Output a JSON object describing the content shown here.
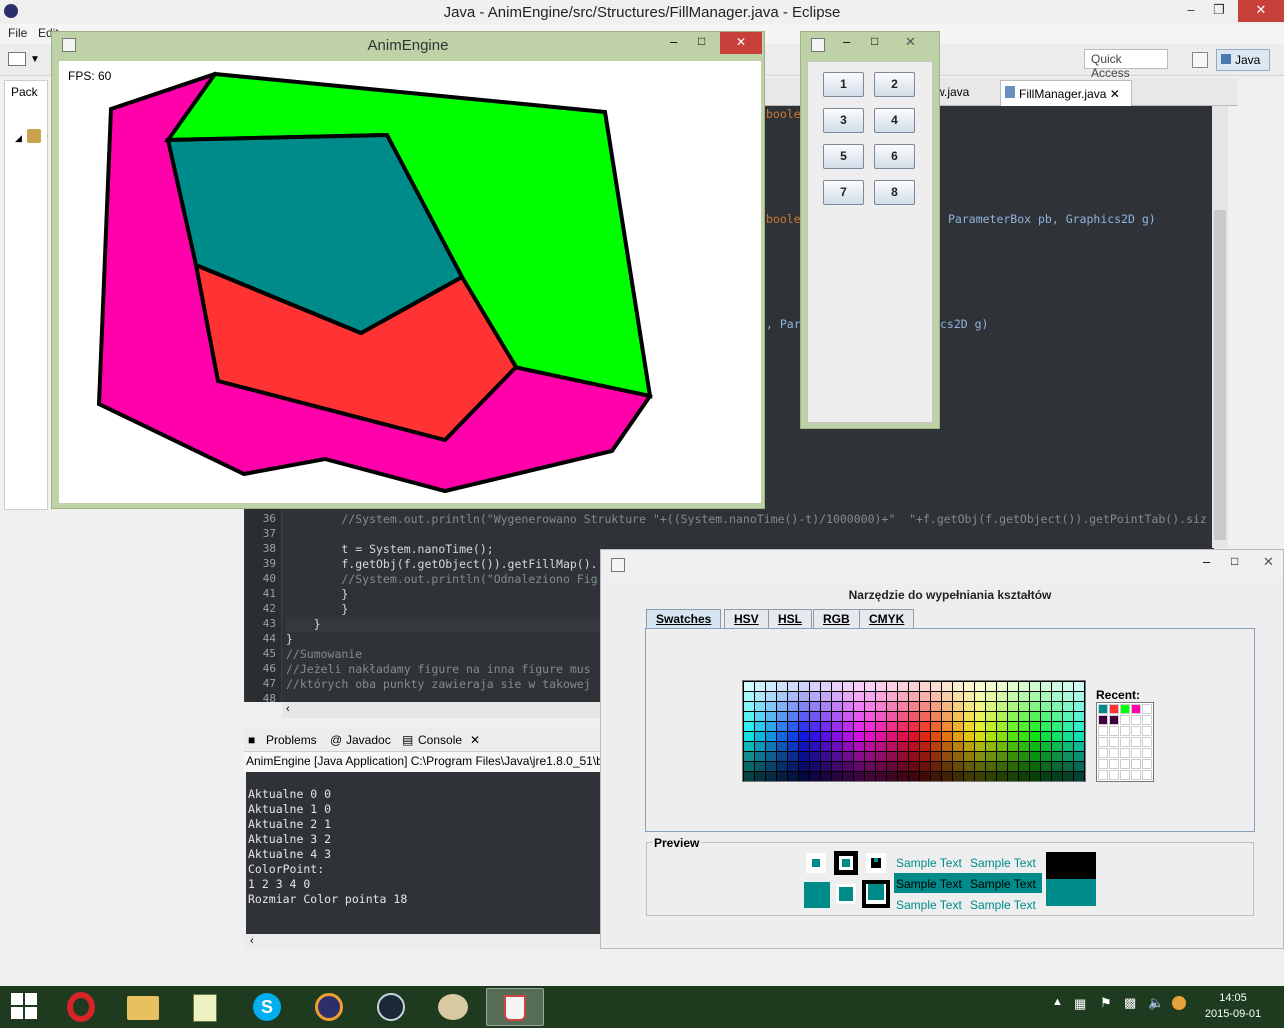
{
  "eclipse": {
    "title": "Java - AnimEngine/src/Structures/FillManager.java - Eclipse",
    "menu": [
      "File",
      "Edit"
    ],
    "quick_access": "Quick Access",
    "perspective": "Java",
    "package_tab": "Pack",
    "editor_tabs": [
      "w.java",
      "FillManager.java"
    ],
    "code": [
      {
        "n": "36",
        "text": "        //System.out.println(\"Wygenerowano Strukture \"+((System.nanoTime()-t)/1000000)+\"  \"+f.getObj(f.getObject()).getPointTab().siz"
      },
      {
        "n": "37",
        "text": ""
      },
      {
        "n": "38",
        "text": "        t = System.nanoTime();"
      },
      {
        "n": "39",
        "text": "        f.getObj(f.getObject()).getFillMap()."
      },
      {
        "n": "40",
        "text": "        //System.out.println(\"Odnaleziono Fig"
      },
      {
        "n": "41",
        "text": "        }"
      },
      {
        "n": "42",
        "text": "        }"
      },
      {
        "n": "43",
        "text": "    }"
      },
      {
        "n": "44",
        "text": "}"
      },
      {
        "n": "45",
        "text": "//Sumowanie"
      },
      {
        "n": "46",
        "text": "//Jeżeli nakładamy figure na inna figure mus"
      },
      {
        "n": "47",
        "text": "//których oba punkty zawieraja sie w takowej"
      },
      {
        "n": "48",
        "text": ""
      }
    ],
    "code_fragments": [
      "boole",
      "boole",
      "ParameterBox pb, Graphics2D g)",
      ", Par",
      "cs2D g)"
    ]
  },
  "console": {
    "tabs": [
      "Problems",
      "Javadoc",
      "Console"
    ],
    "header": "AnimEngine [Java Application] C:\\Program Files\\Java\\jre1.8.0_51\\bi",
    "lines": [
      "Aktualne 0 0",
      "Aktualne 1 0",
      "Aktualne 2 1",
      "Aktualne 3 2",
      "Aktualne 4 3",
      "ColorPoint:",
      "1 2 3 4 0",
      "Rozmiar Color pointa 18"
    ]
  },
  "anim": {
    "title": "AnimEngine",
    "fps": "FPS: 60",
    "colors": {
      "magenta": "#ff00aa",
      "green": "#00ff00",
      "teal": "#008b8b",
      "red": "#ff3333"
    }
  },
  "buttons": [
    "1",
    "2",
    "3",
    "4",
    "5",
    "6",
    "7",
    "8"
  ],
  "fill_tool": {
    "heading": "Narzędzie do wypełniania kształtów",
    "tabs": [
      "Swatches",
      "HSV",
      "HSL",
      "RGB",
      "CMYK"
    ],
    "recent_label": "Recent:",
    "recent_colors": [
      "#008b8b",
      "#ff3333",
      "#00ff00",
      "#ff00aa",
      "#400040",
      "#400040"
    ],
    "preview_label": "Preview",
    "sample_text": "Sample Text",
    "preview_color": "#008b8b"
  },
  "taskbar": {
    "time": "14:05",
    "date": "2015-09-01"
  }
}
